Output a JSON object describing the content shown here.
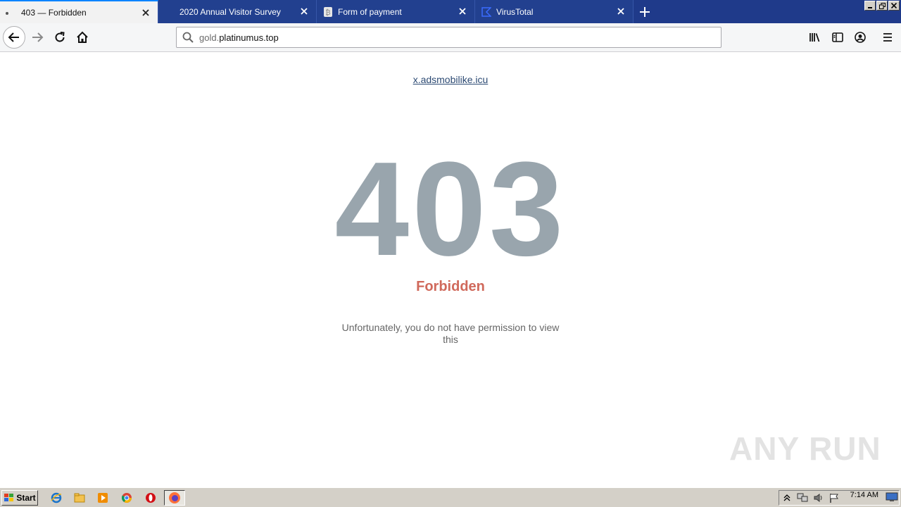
{
  "tabs": [
    {
      "title": "403 — Forbidden",
      "active": true
    },
    {
      "title": "2020 Annual Visitor Survey",
      "active": false
    },
    {
      "title": "Form of payment",
      "active": false
    },
    {
      "title": "VirusTotal",
      "active": false
    }
  ],
  "urlbar": {
    "domain_prefix": "gold.",
    "domain_main": "platinumus.top"
  },
  "page": {
    "top_link": "x.adsmobilike.icu",
    "code": "403",
    "status": "Forbidden",
    "message": "Unfortunately, you do not have permission to view this"
  },
  "watermark": "ANY RUN",
  "taskbar": {
    "start_label": "Start",
    "clock": "7:14 AM"
  },
  "colors": {
    "tabstrip": "#1f3a8a",
    "code": "#99a5ad",
    "status": "#d0695b",
    "link": "#2c4a73"
  }
}
